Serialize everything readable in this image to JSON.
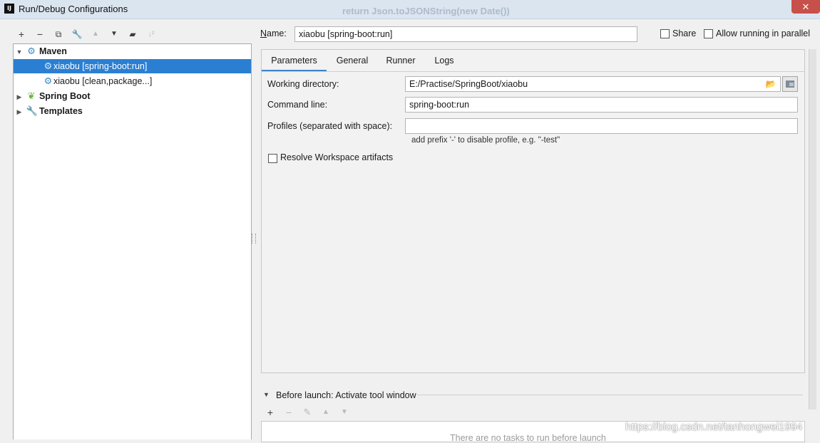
{
  "window": {
    "title": "Run/Debug Configurations",
    "app_icon": "IJ",
    "background_code_snippet": "return Json.toJSONString(new Date())",
    "close_label": "✕"
  },
  "toolbar": {
    "add": "+",
    "remove": "−",
    "copy": "⧉",
    "edit_defaults": "🔧",
    "move_up": "▲",
    "move_down": "▼",
    "new_folder": "▰",
    "sort": "↓²"
  },
  "tree": {
    "groups": [
      {
        "label": "Maven",
        "expanded": true,
        "icon": "maven-gear-icon"
      },
      {
        "label": "Spring Boot",
        "expanded": false,
        "icon": "spring-boot-icon"
      },
      {
        "label": "Templates",
        "expanded": false,
        "icon": "wrench-icon"
      }
    ],
    "maven_items": [
      {
        "label": "xiaobu [spring-boot:run]",
        "selected": true
      },
      {
        "label": "xiaobu [clean,package...]",
        "selected": false
      }
    ]
  },
  "config": {
    "name_label": "Name:",
    "name_value": "xiaobu [spring-boot:run]",
    "share_label": "Share",
    "share_checked": false,
    "parallel_label": "Allow running in parallel",
    "parallel_checked": false
  },
  "tabs": [
    {
      "label": "Parameters",
      "active": true
    },
    {
      "label": "General",
      "active": false
    },
    {
      "label": "Runner",
      "active": false
    },
    {
      "label": "Logs",
      "active": false
    }
  ],
  "parameters": {
    "working_dir_label": "Working directory:",
    "working_dir_value": "E:/Practise/SpringBoot/xiaobu",
    "command_line_label": "Command line:",
    "command_line_value": "spring-boot:run",
    "profiles_label": "Profiles (separated with space):",
    "profiles_value": "",
    "profiles_hint": "add prefix '-' to disable profile, e.g. \"-test\"",
    "resolve_label": "Resolve Workspace artifacts",
    "resolve_checked": false
  },
  "before_launch": {
    "label": "Before launch: Activate tool window",
    "add": "+",
    "remove": "−",
    "edit": "✎",
    "up": "▲",
    "down": "▼",
    "empty_text": "There are no tasks to run before launch"
  },
  "watermark": "https://blog.csdn.net/tanhongwei1994",
  "colors": {
    "selection": "#2b7fd2",
    "tab_underline": "#4083c9",
    "close_button": "#c7504a"
  }
}
